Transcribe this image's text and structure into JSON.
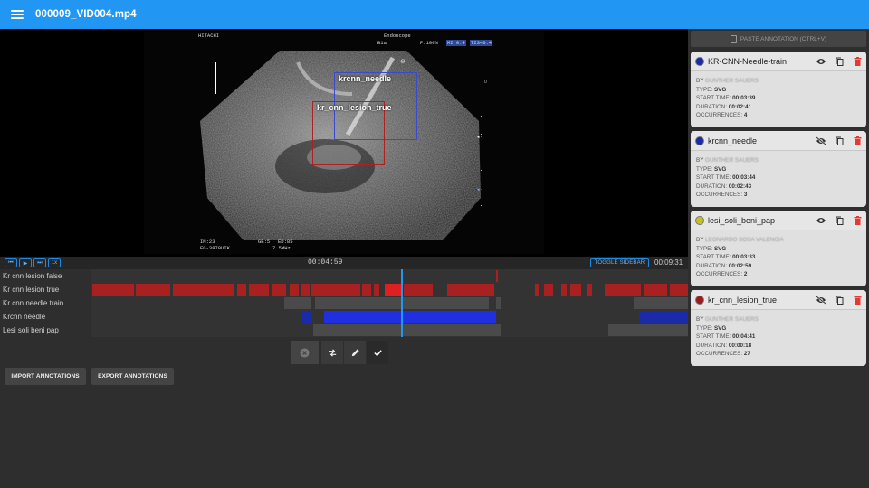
{
  "header": {
    "title": "000009_VID004.mp4"
  },
  "video": {
    "overlay": {
      "brand": "HITACHI",
      "mode": "Endoscope",
      "b_mode": "B1a",
      "power": "P:100%",
      "mi": "MI 0.4",
      "tis": "TIS<0.4",
      "im": "IM:23",
      "probe": "EG-3870UTK",
      "gain": "GB:5",
      "ed": "ED:85",
      "freq": "7.5MHz",
      "depth_mark": "0"
    },
    "annotations": [
      {
        "label": "krcnn_needle",
        "color": "#3040c0"
      },
      {
        "label": "kr_cnn_lesion_true",
        "color": "#b02020"
      }
    ]
  },
  "timeline": {
    "controls": [
      "⏮",
      "▶",
      "⏭",
      "1x"
    ],
    "current_time": "00:04:59",
    "toggle_sidebar": "TOGGLE SIDEBAR",
    "end_time": "00:09:31",
    "tracks": [
      {
        "label": "Kr cnn lesion false"
      },
      {
        "label": "Kr cnn lesion true"
      },
      {
        "label": "Kr cnn needle train"
      },
      {
        "label": "Krcnn needle"
      },
      {
        "label": "Lesi soli beni pap"
      }
    ]
  },
  "toolbar": {
    "icons": [
      "clear-icon",
      "swap-icon",
      "pencil-icon",
      "check-icon"
    ]
  },
  "actions": {
    "import": "IMPORT ANNOTATIONS",
    "export": "EXPORT ANNOTATIONS"
  },
  "sidebar": {
    "paste": "PASTE ANNOTATION (CTRL+V)",
    "cards": [
      {
        "title": "KR-CNN-Needle-train",
        "color": "#1a2aa8",
        "by_label": "BY",
        "by": "GUNTHER SAUERS",
        "type_label": "TYPE:",
        "type": "SVG",
        "start_label": "START TIME:",
        "start": "00:03:39",
        "dur_label": "DURATION:",
        "duration": "00:02:41",
        "occ_label": "OCCURRENCES:",
        "occ": "4",
        "visible": true
      },
      {
        "title": "krcnn_needle",
        "color": "#1a2aa8",
        "by_label": "BY",
        "by": "GUNTHER SAUERS",
        "type_label": "TYPE:",
        "type": "SVG",
        "start_label": "START TIME:",
        "start": "00:03:44",
        "dur_label": "DURATION:",
        "duration": "00:02:43",
        "occ_label": "OCCURRENCES:",
        "occ": "3",
        "visible": false
      },
      {
        "title": "lesi_soli_beni_pap",
        "color": "#c8c020",
        "by_label": "BY",
        "by": "LEONARDO SOSA VALENCIA",
        "type_label": "TYPE:",
        "type": "SVG",
        "start_label": "START TIME:",
        "start": "00:03:33",
        "dur_label": "DURATION:",
        "duration": "00:02:59",
        "occ_label": "OCCURRENCES:",
        "occ": "2",
        "visible": true
      },
      {
        "title": "kr_cnn_lesion_true",
        "color": "#a01818",
        "by_label": "BY",
        "by": "GUNTHER SAUERS",
        "type_label": "TYPE:",
        "type": "SVG",
        "start_label": "START TIME:",
        "start": "00:04:41",
        "dur_label": "DURATION:",
        "duration": "00:00:18",
        "occ_label": "OCCURRENCES:",
        "occ": "27",
        "visible": false
      }
    ]
  },
  "colors": {
    "accent": "#2196f3",
    "lesion_true": "#a82020",
    "needle": "#2030e0",
    "track_gray": "#4a4a4a"
  }
}
